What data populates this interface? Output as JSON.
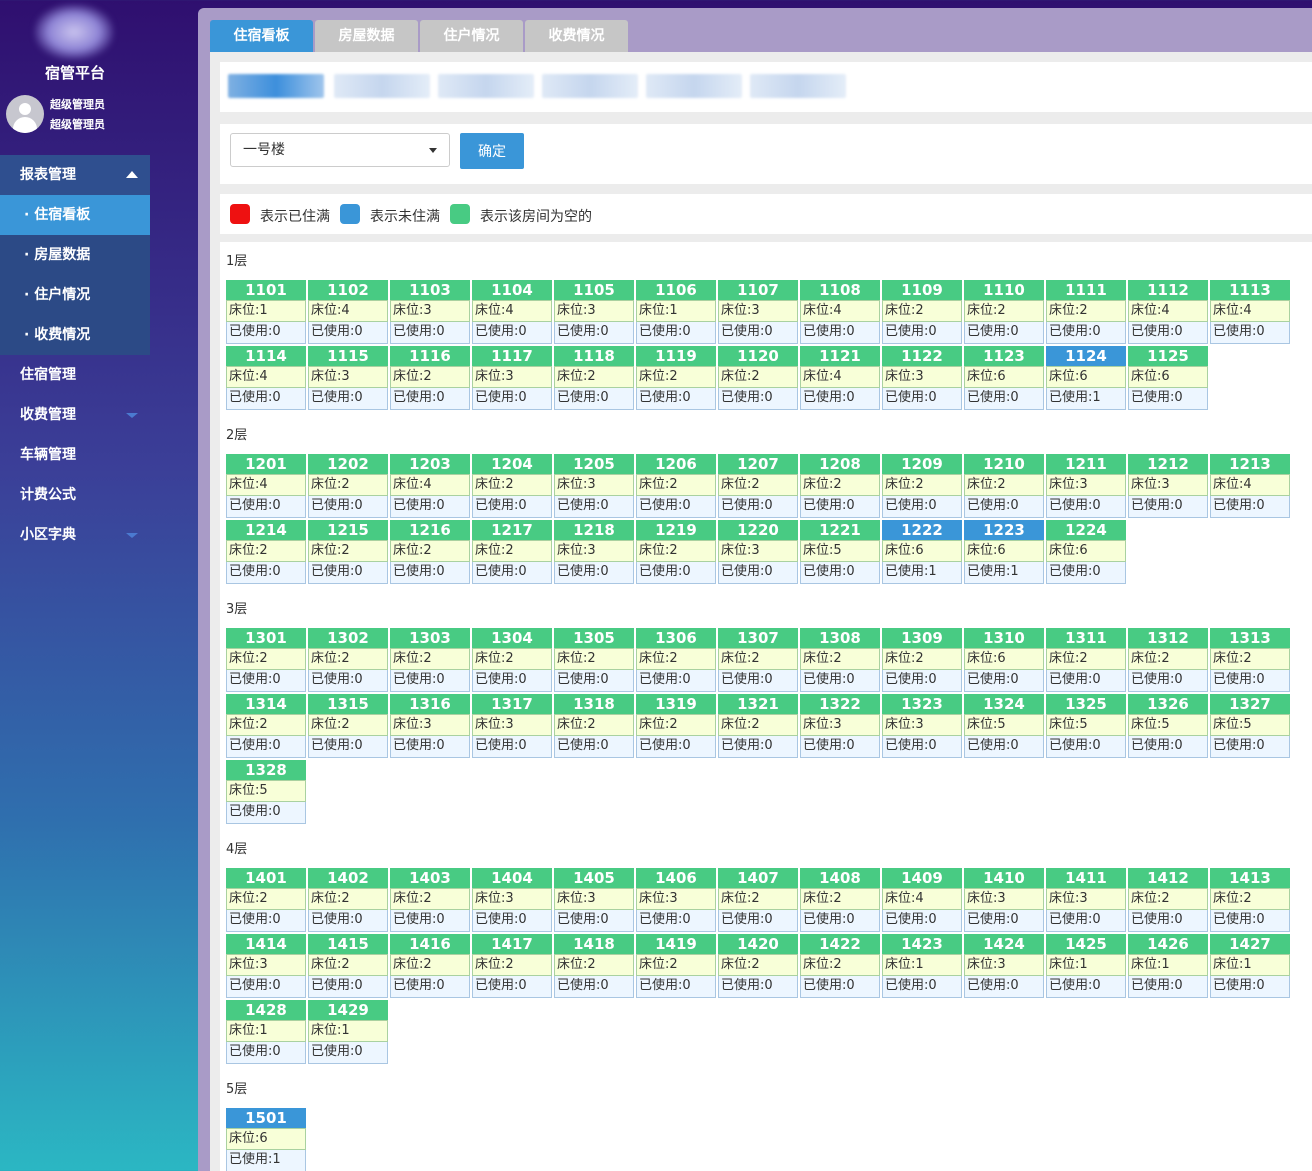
{
  "app": {
    "title": "宿管平台",
    "user_line1": "超级管理员",
    "user_line2": "超级管理员"
  },
  "sidebar": {
    "menus": [
      {
        "label": "报表管理",
        "open": true,
        "children": [
          "住宿看板",
          "房屋数据",
          "住户情况",
          "收费情况"
        ],
        "active_child": 0
      },
      {
        "label": "住宿管理"
      },
      {
        "label": "收费管理",
        "has_arrow": true
      },
      {
        "label": "车辆管理"
      },
      {
        "label": "计费公式"
      },
      {
        "label": "小区字典",
        "has_arrow": true
      }
    ]
  },
  "tabs": [
    "住宿看板",
    "房屋数据",
    "住户情况",
    "收费情况"
  ],
  "filter": {
    "building_selected": "一号楼",
    "confirm_label": "确定"
  },
  "legend": [
    {
      "text": "表示已住满",
      "color": "#ee1111"
    },
    {
      "text": "表示未住满",
      "color": "#3a96d8"
    },
    {
      "text": "表示该房间为空的",
      "color": "#48cb83"
    }
  ],
  "labels": {
    "beds_prefix": "床位:",
    "used_prefix": "已使用:"
  },
  "colors": {
    "empty": "#48cb83",
    "partial": "#3a96d8",
    "full": "#ee1111"
  },
  "floors": [
    {
      "label": "1层",
      "rooms": [
        {
          "no": "1101",
          "beds": 1,
          "used": 0
        },
        {
          "no": "1102",
          "beds": 4,
          "used": 0
        },
        {
          "no": "1103",
          "beds": 3,
          "used": 0
        },
        {
          "no": "1104",
          "beds": 4,
          "used": 0
        },
        {
          "no": "1105",
          "beds": 3,
          "used": 0
        },
        {
          "no": "1106",
          "beds": 1,
          "used": 0
        },
        {
          "no": "1107",
          "beds": 3,
          "used": 0
        },
        {
          "no": "1108",
          "beds": 4,
          "used": 0
        },
        {
          "no": "1109",
          "beds": 2,
          "used": 0
        },
        {
          "no": "1110",
          "beds": 2,
          "used": 0
        },
        {
          "no": "1111",
          "beds": 2,
          "used": 0
        },
        {
          "no": "1112",
          "beds": 4,
          "used": 0
        },
        {
          "no": "1113",
          "beds": 4,
          "used": 0
        },
        {
          "no": "1114",
          "beds": 4,
          "used": 0
        },
        {
          "no": "1115",
          "beds": 3,
          "used": 0
        },
        {
          "no": "1116",
          "beds": 2,
          "used": 0
        },
        {
          "no": "1117",
          "beds": 3,
          "used": 0
        },
        {
          "no": "1118",
          "beds": 2,
          "used": 0
        },
        {
          "no": "1119",
          "beds": 2,
          "used": 0
        },
        {
          "no": "1120",
          "beds": 2,
          "used": 0
        },
        {
          "no": "1121",
          "beds": 4,
          "used": 0
        },
        {
          "no": "1122",
          "beds": 3,
          "used": 0
        },
        {
          "no": "1123",
          "beds": 6,
          "used": 0
        },
        {
          "no": "1124",
          "beds": 6,
          "used": 1
        },
        {
          "no": "1125",
          "beds": 6,
          "used": 0
        }
      ]
    },
    {
      "label": "2层",
      "rooms": [
        {
          "no": "1201",
          "beds": 4,
          "used": 0
        },
        {
          "no": "1202",
          "beds": 2,
          "used": 0
        },
        {
          "no": "1203",
          "beds": 4,
          "used": 0
        },
        {
          "no": "1204",
          "beds": 2,
          "used": 0
        },
        {
          "no": "1205",
          "beds": 3,
          "used": 0
        },
        {
          "no": "1206",
          "beds": 2,
          "used": 0
        },
        {
          "no": "1207",
          "beds": 2,
          "used": 0
        },
        {
          "no": "1208",
          "beds": 2,
          "used": 0
        },
        {
          "no": "1209",
          "beds": 2,
          "used": 0
        },
        {
          "no": "1210",
          "beds": 2,
          "used": 0
        },
        {
          "no": "1211",
          "beds": 3,
          "used": 0
        },
        {
          "no": "1212",
          "beds": 3,
          "used": 0
        },
        {
          "no": "1213",
          "beds": 4,
          "used": 0
        },
        {
          "no": "1214",
          "beds": 2,
          "used": 0
        },
        {
          "no": "1215",
          "beds": 2,
          "used": 0
        },
        {
          "no": "1216",
          "beds": 2,
          "used": 0
        },
        {
          "no": "1217",
          "beds": 2,
          "used": 0
        },
        {
          "no": "1218",
          "beds": 3,
          "used": 0
        },
        {
          "no": "1219",
          "beds": 2,
          "used": 0
        },
        {
          "no": "1220",
          "beds": 3,
          "used": 0
        },
        {
          "no": "1221",
          "beds": 5,
          "used": 0
        },
        {
          "no": "1222",
          "beds": 6,
          "used": 1
        },
        {
          "no": "1223",
          "beds": 6,
          "used": 1
        },
        {
          "no": "1224",
          "beds": 6,
          "used": 0
        }
      ]
    },
    {
      "label": "3层",
      "rooms": [
        {
          "no": "1301",
          "beds": 2,
          "used": 0
        },
        {
          "no": "1302",
          "beds": 2,
          "used": 0
        },
        {
          "no": "1303",
          "beds": 2,
          "used": 0
        },
        {
          "no": "1304",
          "beds": 2,
          "used": 0
        },
        {
          "no": "1305",
          "beds": 2,
          "used": 0
        },
        {
          "no": "1306",
          "beds": 2,
          "used": 0
        },
        {
          "no": "1307",
          "beds": 2,
          "used": 0
        },
        {
          "no": "1308",
          "beds": 2,
          "used": 0
        },
        {
          "no": "1309",
          "beds": 2,
          "used": 0
        },
        {
          "no": "1310",
          "beds": 6,
          "used": 0
        },
        {
          "no": "1311",
          "beds": 2,
          "used": 0
        },
        {
          "no": "1312",
          "beds": 2,
          "used": 0
        },
        {
          "no": "1313",
          "beds": 2,
          "used": 0
        },
        {
          "no": "1314",
          "beds": 2,
          "used": 0
        },
        {
          "no": "1315",
          "beds": 2,
          "used": 0
        },
        {
          "no": "1316",
          "beds": 3,
          "used": 0
        },
        {
          "no": "1317",
          "beds": 3,
          "used": 0
        },
        {
          "no": "1318",
          "beds": 2,
          "used": 0
        },
        {
          "no": "1319",
          "beds": 2,
          "used": 0
        },
        {
          "no": "1321",
          "beds": 2,
          "used": 0
        },
        {
          "no": "1322",
          "beds": 3,
          "used": 0
        },
        {
          "no": "1323",
          "beds": 3,
          "used": 0
        },
        {
          "no": "1324",
          "beds": 5,
          "used": 0
        },
        {
          "no": "1325",
          "beds": 5,
          "used": 0
        },
        {
          "no": "1326",
          "beds": 5,
          "used": 0
        },
        {
          "no": "1327",
          "beds": 5,
          "used": 0
        },
        {
          "no": "1328",
          "beds": 5,
          "used": 0
        }
      ]
    },
    {
      "label": "4层",
      "rooms": [
        {
          "no": "1401",
          "beds": 2,
          "used": 0
        },
        {
          "no": "1402",
          "beds": 2,
          "used": 0
        },
        {
          "no": "1403",
          "beds": 2,
          "used": 0
        },
        {
          "no": "1404",
          "beds": 3,
          "used": 0
        },
        {
          "no": "1405",
          "beds": 3,
          "used": 0
        },
        {
          "no": "1406",
          "beds": 3,
          "used": 0
        },
        {
          "no": "1407",
          "beds": 2,
          "used": 0
        },
        {
          "no": "1408",
          "beds": 2,
          "used": 0
        },
        {
          "no": "1409",
          "beds": 4,
          "used": 0
        },
        {
          "no": "1410",
          "beds": 3,
          "used": 0
        },
        {
          "no": "1411",
          "beds": 3,
          "used": 0
        },
        {
          "no": "1412",
          "beds": 2,
          "used": 0
        },
        {
          "no": "1413",
          "beds": 2,
          "used": 0
        },
        {
          "no": "1414",
          "beds": 3,
          "used": 0
        },
        {
          "no": "1415",
          "beds": 2,
          "used": 0
        },
        {
          "no": "1416",
          "beds": 2,
          "used": 0
        },
        {
          "no": "1417",
          "beds": 2,
          "used": 0
        },
        {
          "no": "1418",
          "beds": 2,
          "used": 0
        },
        {
          "no": "1419",
          "beds": 2,
          "used": 0
        },
        {
          "no": "1420",
          "beds": 2,
          "used": 0
        },
        {
          "no": "1422",
          "beds": 2,
          "used": 0
        },
        {
          "no": "1423",
          "beds": 1,
          "used": 0
        },
        {
          "no": "1424",
          "beds": 3,
          "used": 0
        },
        {
          "no": "1425",
          "beds": 1,
          "used": 0
        },
        {
          "no": "1426",
          "beds": 1,
          "used": 0
        },
        {
          "no": "1427",
          "beds": 1,
          "used": 0
        },
        {
          "no": "1428",
          "beds": 1,
          "used": 0
        },
        {
          "no": "1429",
          "beds": 1,
          "used": 0
        }
      ]
    },
    {
      "label": "5层",
      "rooms": [
        {
          "no": "1501",
          "beds": 6,
          "used": 1
        }
      ]
    }
  ]
}
